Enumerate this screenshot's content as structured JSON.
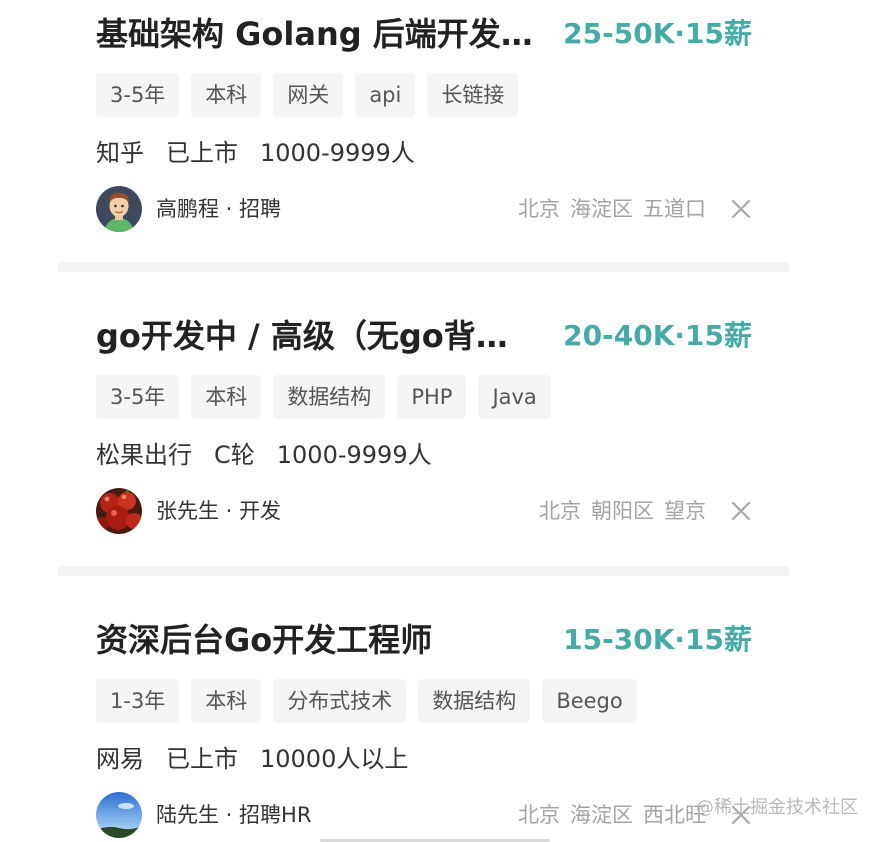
{
  "jobs": [
    {
      "title": "基础架构 Golang 后端开发…",
      "salary": "25-50K·15薪",
      "tags": [
        "3-5年",
        "本科",
        "网关",
        "api",
        "长链接"
      ],
      "company": {
        "name": "知乎",
        "stage": "已上市",
        "size": "1000-9999人"
      },
      "recruiter": {
        "label": "高鹏程 · 招聘",
        "avatar": "cartoon-man-avatar"
      },
      "location": {
        "city": "北京",
        "district": "海淀区",
        "area": "五道口"
      }
    },
    {
      "title": "go开发中 / 高级（无go背…",
      "salary": "20-40K·15薪",
      "tags": [
        "3-5年",
        "本科",
        "数据结构",
        "PHP",
        "Java"
      ],
      "company": {
        "name": "松果出行",
        "stage": "C轮",
        "size": "1000-9999人"
      },
      "recruiter": {
        "label": "张先生 · 开发",
        "avatar": "red-fruit-avatar"
      },
      "location": {
        "city": "北京",
        "district": "朝阳区",
        "area": "望京"
      }
    },
    {
      "title": "资深后台Go开发工程师",
      "salary": "15-30K·15薪",
      "tags": [
        "1-3年",
        "本科",
        "分布式技术",
        "数据结构",
        "Beego"
      ],
      "company": {
        "name": "网易",
        "stage": "已上市",
        "size": "10000人以上"
      },
      "recruiter": {
        "label": "陆先生 · 招聘HR",
        "avatar": "blue-sky-avatar"
      },
      "location": {
        "city": "北京",
        "district": "海淀区",
        "area": "西北旺"
      }
    }
  ],
  "watermark": "@稀土掘金技术社区",
  "icons": {
    "dismiss": "close-icon"
  },
  "colors": {
    "salary": "#46aaa5",
    "title": "#222222",
    "tag_background": "#f5f5f5",
    "secondary_text": "#a3a3a3",
    "divider": "#f4f4f4"
  }
}
